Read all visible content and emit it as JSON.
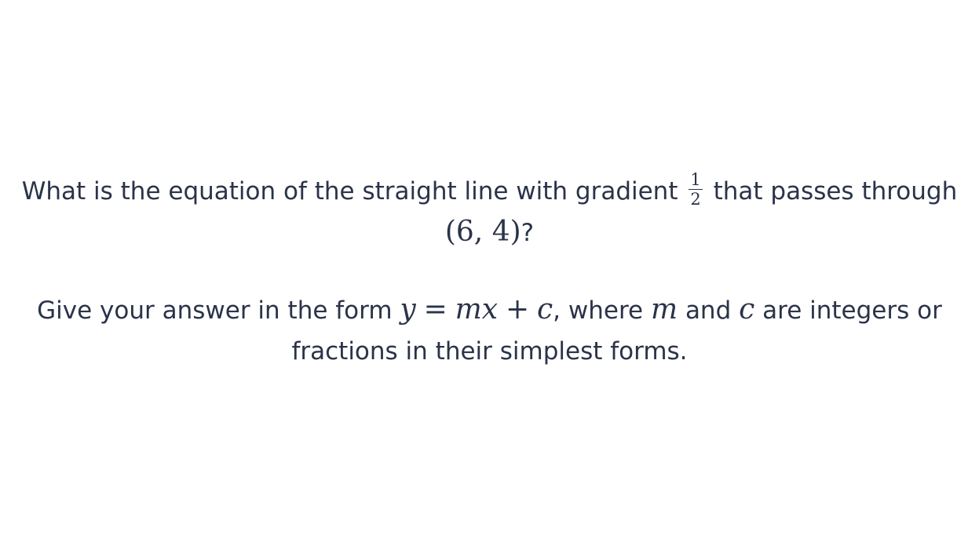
{
  "question": {
    "line1": {
      "text_before": "What is the equation of the straight line with gradient",
      "gradient_numerator": "1",
      "gradient_denominator": "2",
      "text_after": "that passes through",
      "point": "(6, 4)",
      "end": "?"
    },
    "line2": {
      "text_before": "Give your answer in the form",
      "form_y": "y",
      "form_eq": "=",
      "form_mx": "mx",
      "form_plus": "+",
      "form_c": "c",
      "comma_where": ", where",
      "var_m": "m",
      "and": "and",
      "var_c": "c",
      "text_end": "are integers or fractions in their simplest forms."
    }
  }
}
